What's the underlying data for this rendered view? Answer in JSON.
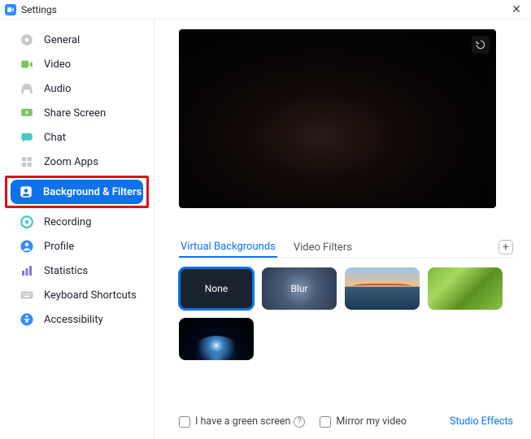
{
  "window": {
    "title": "Settings"
  },
  "sidebar": {
    "items": [
      {
        "label": "General"
      },
      {
        "label": "Video"
      },
      {
        "label": "Audio"
      },
      {
        "label": "Share Screen"
      },
      {
        "label": "Chat"
      },
      {
        "label": "Zoom Apps"
      },
      {
        "label": "Background & Filters"
      },
      {
        "label": "Recording"
      },
      {
        "label": "Profile"
      },
      {
        "label": "Statistics"
      },
      {
        "label": "Keyboard Shortcuts"
      },
      {
        "label": "Accessibility"
      }
    ]
  },
  "tabs": {
    "virtual_backgrounds": "Virtual Backgrounds",
    "video_filters": "Video Filters"
  },
  "thumbnails": {
    "none": "None",
    "blur": "Blur"
  },
  "footer": {
    "green_screen": "I have a green screen",
    "mirror": "Mirror my video",
    "studio": "Studio Effects"
  }
}
